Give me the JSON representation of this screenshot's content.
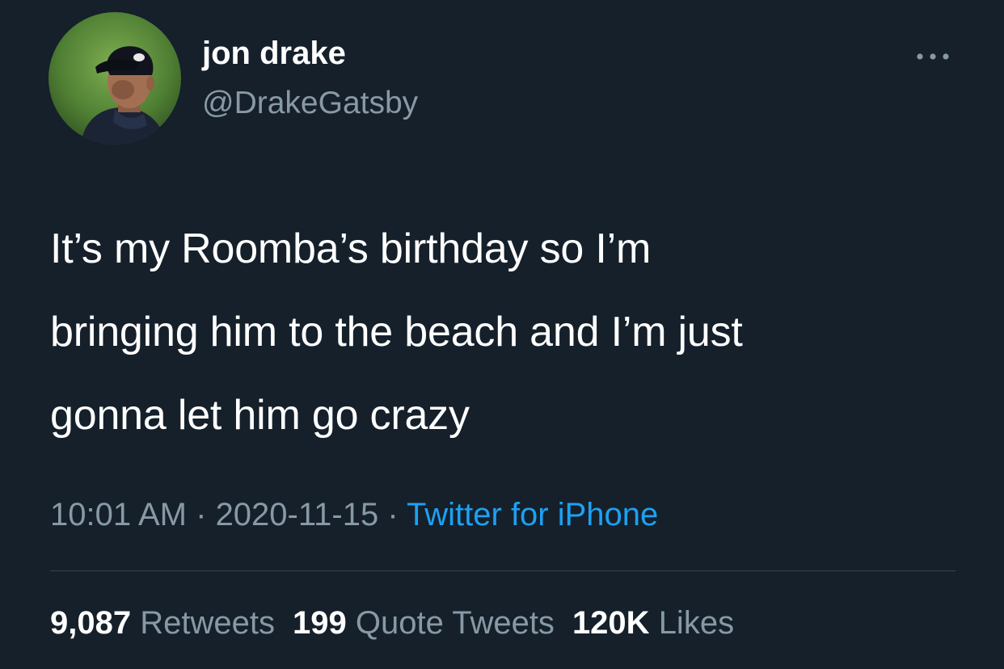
{
  "author": {
    "display_name": "jon drake",
    "handle": "@DrakeGatsby"
  },
  "tweet": {
    "text_lines": [
      "It’s my Roomba’s birthday so I’m",
      "bringing him to the beach and I’m just",
      "gonna let him go crazy"
    ]
  },
  "meta": {
    "time": "10:01 AM",
    "separator": " · ",
    "date": "2020-11-15",
    "source": "Twitter for iPhone"
  },
  "stats": {
    "retweets": {
      "count": "9,087",
      "label": "Retweets"
    },
    "quote_tweets": {
      "count": "199",
      "label": "Quote Tweets"
    },
    "likes": {
      "count": "120K",
      "label": "Likes"
    }
  },
  "icons": {
    "more": "more-horizontal-icon"
  },
  "colors": {
    "background": "#15202b",
    "primary_text": "#ffffff",
    "secondary_text": "#8899a6",
    "link": "#1da1f2",
    "divider": "#38444d"
  }
}
